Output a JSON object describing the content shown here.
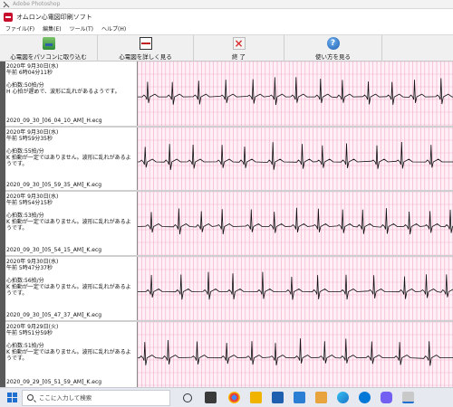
{
  "outer_window": {
    "title": "Adobe Photoshop"
  },
  "window": {
    "title": "オムロン心電図印刷ソフト"
  },
  "menu": [
    "ファイル(F)",
    "編集(E)",
    "ツール(T)",
    "ヘルプ(H)"
  ],
  "toolbar": {
    "import_label": "心電図をパソコンに取り込む",
    "view_label": "心電図を詳しく見る",
    "exit_label": "終 了",
    "help_label": "使い方を見る"
  },
  "records": [
    {
      "date": "2020年 9月30日(水)",
      "time": "午前 6時04分11秒",
      "heart_rate": "心拍数:50拍/分",
      "message": "H 心拍が遅めで、波形に乱れがあるようです。",
      "filename": "2020_09_30_[06_04_10_AM]_H.ecg"
    },
    {
      "date": "2020年 9月30日(水)",
      "time": "午前 5時59分35秒",
      "heart_rate": "心拍数:55拍/分",
      "message": "K 拍動が一定ではありません。波形に乱れがあるようです。",
      "filename": "2020_09_30_[05_59_35_AM]_K.ecg"
    },
    {
      "date": "2020年 9月30日(水)",
      "time": "午前 5時54分15秒",
      "heart_rate": "心拍数:53拍/分",
      "message": "K 拍動が一定ではありません。波形に乱れがあるようです。",
      "filename": "2020_09_30_[05_54_15_AM]_K.ecg"
    },
    {
      "date": "2020年 9月30日(水)",
      "time": "午前 5時47分37秒",
      "heart_rate": "心拍数:56拍/分",
      "message": "K 拍動が一定ではありません。波形に乱れがあるようです。",
      "filename": "2020_09_30_[05_47_37_AM]_K.ecg"
    },
    {
      "date": "2020年 9月29日(火)",
      "time": "午前 5時51分59秒",
      "heart_rate": "心拍数:51拍/分",
      "message": "K 拍動が一定ではありません。波形に乱れがあるようです。",
      "filename": "2020_09_29_[05_51_59_AM]_K.ecg"
    }
  ],
  "ecg_colors": {
    "grid": "#f2a8c6",
    "background": "#fff0f6",
    "trace": "#111111"
  },
  "taskbar": {
    "search_placeholder": "ここに入力して検索",
    "icons": [
      "start-icon",
      "task-view-icon",
      "store-icon",
      "chrome-icon",
      "photos-icon",
      "download-app-icon",
      "vscode-icon",
      "files-icon",
      "edge-icon",
      "skype-icon",
      "viber-icon",
      "ecg-app-icon"
    ]
  }
}
